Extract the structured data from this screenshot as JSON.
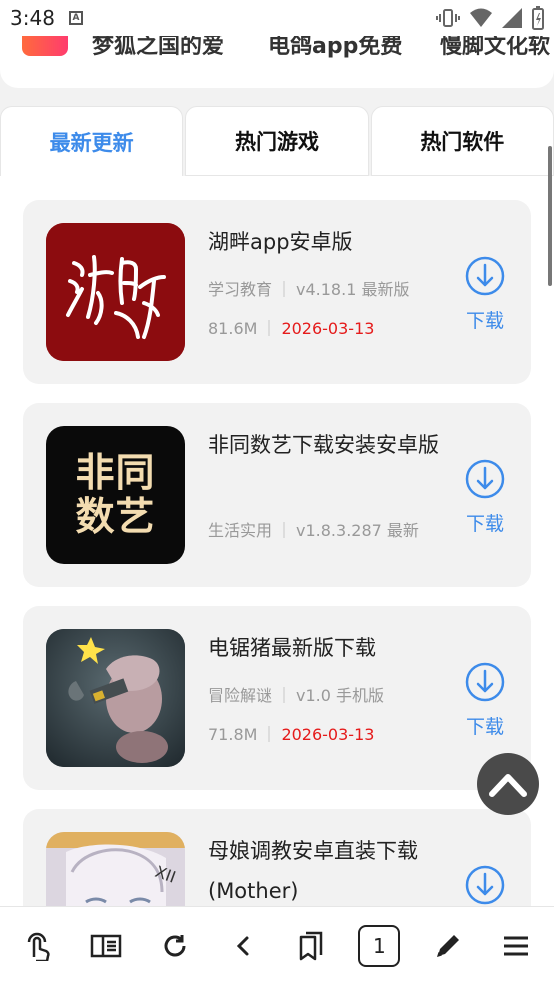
{
  "status": {
    "time": "3:48",
    "notif_letter": "A"
  },
  "top_strip": {
    "items": [
      "梦狐之国的爱",
      "电鸽app免费",
      "慢脚文化软"
    ]
  },
  "tabs": [
    {
      "label": "最新更新",
      "active": true
    },
    {
      "label": "热门游戏",
      "active": false
    },
    {
      "label": "热门软件",
      "active": false
    }
  ],
  "apps": [
    {
      "title": "湖畔app安卓版",
      "category": "学习教育",
      "version": "v4.18.1 最新版",
      "size": "81.6M",
      "date": "2026-03-13",
      "download_label": "下载",
      "icon_text": "湖畔"
    },
    {
      "title": "非同数艺下载安装安卓版",
      "category": "生活实用",
      "version": "v1.8.3.287 最新",
      "size": "",
      "date": "",
      "download_label": "下载",
      "icon_text": "非同数艺"
    },
    {
      "title": "电锯猪最新版下载",
      "category": "冒险解谜",
      "version": "v1.0 手机版",
      "size": "71.8M",
      "date": "2026-03-13",
      "download_label": "下载",
      "icon_text": ""
    },
    {
      "title": "母娘调教安卓直装下载(Mother)",
      "category": "",
      "version": "",
      "size": "",
      "date": "",
      "download_label": "",
      "icon_text": ""
    }
  ],
  "toolbar": {
    "tab_count": "1"
  },
  "colors": {
    "accent": "#3d8bea",
    "date": "#e51b1b"
  }
}
